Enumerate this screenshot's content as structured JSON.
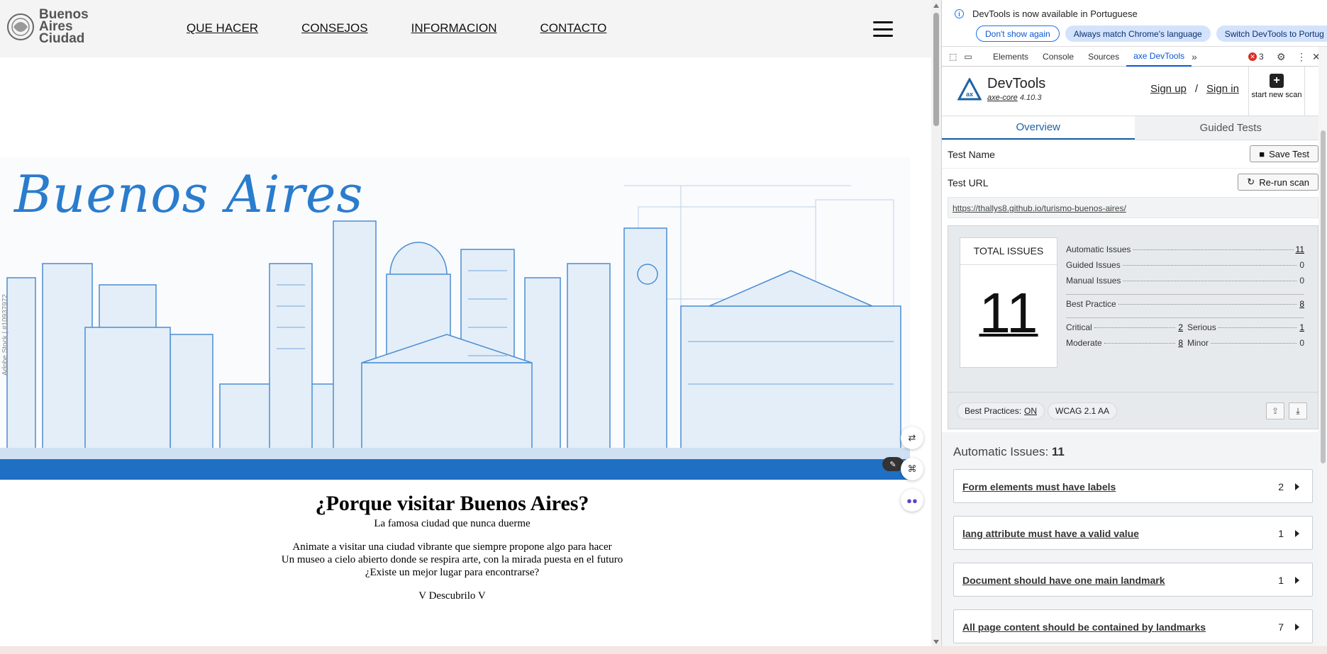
{
  "site": {
    "logo": {
      "line1": "Buenos",
      "line2": "Aires",
      "line3": "Ciudad"
    },
    "nav": [
      "QUE HACER",
      "CONSEJOS",
      "INFORMACION",
      "CONTACTO"
    ],
    "hero_title": "Buenos Aires",
    "watermark": "Adobe Stock | #10937972",
    "intro": {
      "heading": "¿Porque visitar Buenos Aires?",
      "subheading": "La famosa ciudad que nunca duerme",
      "line1": "Animate a visitar una ciudad vibrante que siempre propone algo para hacer",
      "line2": "Un museo a cielo abierto donde se respira arte, con la mirada puesta en el futuro",
      "line3": "¿Existe un mejor lugar para encontrarse?",
      "cta": "V Descubrilo V"
    }
  },
  "devtools": {
    "infobar": {
      "message": "DevTools is now available in Portuguese",
      "btn_dont_show": "Don't show again",
      "btn_match": "Always match Chrome's language",
      "btn_switch": "Switch DevTools to Portug"
    },
    "tabs": [
      "Elements",
      "Console",
      "Sources",
      "axe DevTools"
    ],
    "error_count": "3",
    "axe": {
      "title": "DevTools",
      "version_link": "axe-core",
      "version": " 4.10.3",
      "sign_up": "Sign up",
      "slash": "/",
      "sign_in": "Sign in",
      "new_scan": "start new scan",
      "tab_overview": "Overview",
      "tab_guided": "Guided Tests",
      "test_name_label": "Test Name",
      "save_test": "Save Test",
      "test_url_label": "Test URL",
      "rerun": "Re-run scan",
      "url": "https://thallys8.github.io/turismo-buenos-aires/",
      "total_label": "TOTAL ISSUES",
      "total": "11",
      "counts": {
        "automatic_label": "Automatic Issues",
        "automatic": "11",
        "guided_label": "Guided Issues",
        "guided": "0",
        "manual_label": "Manual Issues",
        "manual": "0",
        "best_label": "Best Practice",
        "best": "8",
        "critical_label": "Critical",
        "critical": "2",
        "serious_label": "Serious",
        "serious": "1",
        "moderate_label": "Moderate",
        "moderate": "8",
        "minor_label": "Minor",
        "minor": "0"
      },
      "best_practices_tag": "Best Practices:",
      "best_practices_state": "ON",
      "wcag_tag": "WCAG 2.1 AA",
      "auto_heading": "Automatic Issues:",
      "auto_count": "11",
      "issues": [
        {
          "title": "Form elements must have labels",
          "count": "2"
        },
        {
          "title": "lang attribute must have a valid value",
          "count": "1"
        },
        {
          "title": "Document should have one main landmark",
          "count": "1"
        },
        {
          "title": "All page content should be contained by landmarks",
          "count": "7"
        }
      ]
    }
  }
}
